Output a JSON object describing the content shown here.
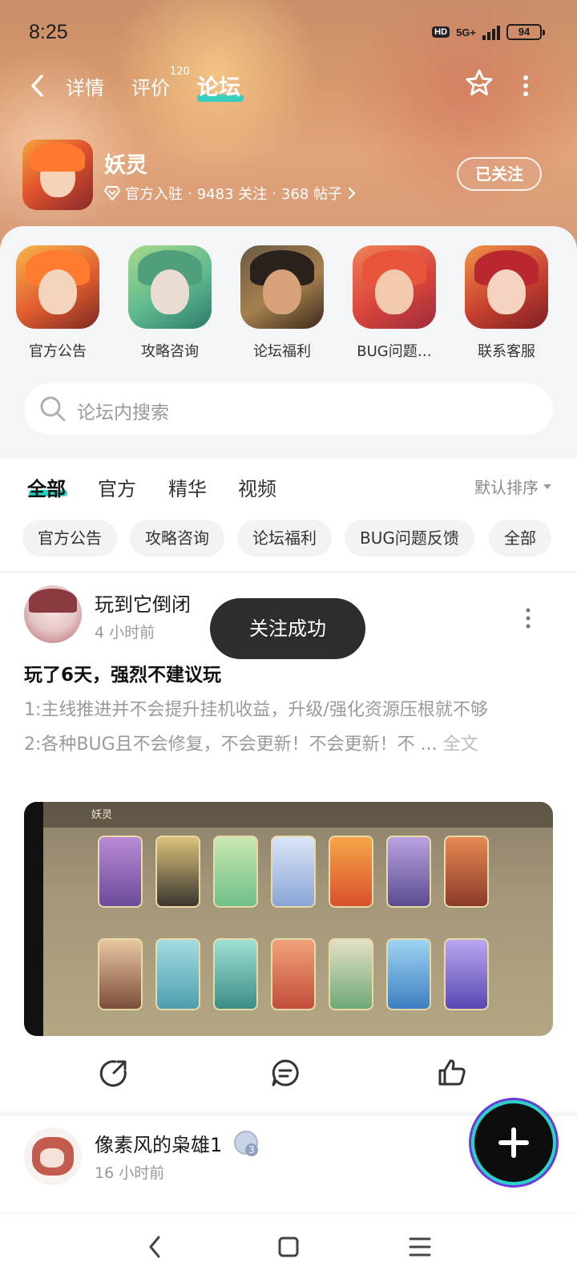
{
  "status_bar": {
    "time": "8:25",
    "network": "5G+",
    "battery": "94",
    "hd": "HD"
  },
  "topnav": {
    "tabs": [
      {
        "label": "详情"
      },
      {
        "label": "评价",
        "count": "120"
      },
      {
        "label": "论坛"
      }
    ],
    "active_tab": "论坛"
  },
  "game": {
    "name": "妖灵",
    "official": "官方入驻",
    "followers": "9483 关注",
    "posts": "368 帖子",
    "sep": "·",
    "follow_button": "已关注"
  },
  "sections": [
    {
      "label": "官方公告"
    },
    {
      "label": "攻略咨询"
    },
    {
      "label": "论坛福利"
    },
    {
      "label": "BUG问题…"
    },
    {
      "label": "联系客服"
    }
  ],
  "search": {
    "placeholder": "论坛内搜索"
  },
  "feed_tabs": [
    {
      "label": "全部"
    },
    {
      "label": "官方"
    },
    {
      "label": "精华"
    },
    {
      "label": "视频"
    }
  ],
  "sort_label": "默认排序",
  "chips": [
    {
      "label": "官方公告"
    },
    {
      "label": "攻略咨询"
    },
    {
      "label": "论坛福利"
    },
    {
      "label": "BUG问题反馈"
    },
    {
      "label": "全部"
    }
  ],
  "post1": {
    "author": "玩到它倒闭",
    "time": "4 小时前",
    "title": "玩了6天，强烈不建议玩",
    "line1": "1:主线推进并不会提升挂机收益，升级/强化资源压根就不够",
    "line2": "2:各种BUG且不会修复，不会更新！不会更新！不 ...",
    "fulltext": "全文",
    "image_title": "妖灵"
  },
  "post2": {
    "author": "像素风的枭雄1",
    "time": "16 小时前",
    "level": "3"
  },
  "toast": "关注成功",
  "colors": {
    "accent": "#25d0c4",
    "toast_bg": "#2d2d2d"
  }
}
